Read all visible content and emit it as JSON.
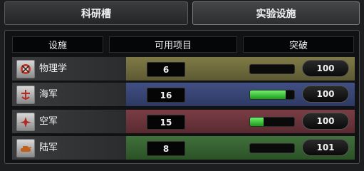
{
  "tabs": [
    {
      "label": "科研槽",
      "active": false
    },
    {
      "label": "实验设施",
      "active": true
    }
  ],
  "headers": {
    "facility": "设施",
    "available_projects": "可用项目",
    "breakthrough": "突破"
  },
  "rows": [
    {
      "name": "物理学",
      "count": "6",
      "progress_percent": 0,
      "button": "100",
      "icon": "physics-icon",
      "color": "#7f7a46"
    },
    {
      "name": "海军",
      "count": "16",
      "progress_percent": 80,
      "button": "100",
      "icon": "navy-icon",
      "color": "#414f84"
    },
    {
      "name": "空军",
      "count": "15",
      "progress_percent": 30,
      "button": "100",
      "icon": "airforce-icon",
      "color": "#7a3d45"
    },
    {
      "name": "陆军",
      "count": "8",
      "progress_percent": 0,
      "button": "101",
      "icon": "army-tank-icon",
      "color": "#40703b"
    }
  ]
}
